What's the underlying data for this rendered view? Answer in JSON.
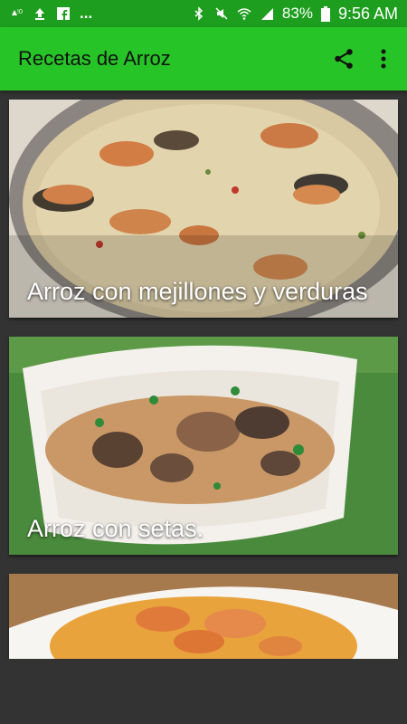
{
  "status_bar": {
    "left_icons": [
      "sync-alert-icon",
      "upload-icon",
      "facebook-icon",
      "more-dots"
    ],
    "more": "...",
    "battery": "83%",
    "time": "9:56 AM"
  },
  "app_bar": {
    "title": "Recetas de Arroz",
    "share_icon": "share-icon",
    "menu_icon": "more-vert-icon"
  },
  "recipes": [
    {
      "title": "Arroz con mejillones y verduras"
    },
    {
      "title": "Arroz con setas."
    },
    {
      "title": ""
    }
  ],
  "colors": {
    "status_bar": "#1e9e1e",
    "app_bar": "#27c427",
    "background": "#333333"
  }
}
